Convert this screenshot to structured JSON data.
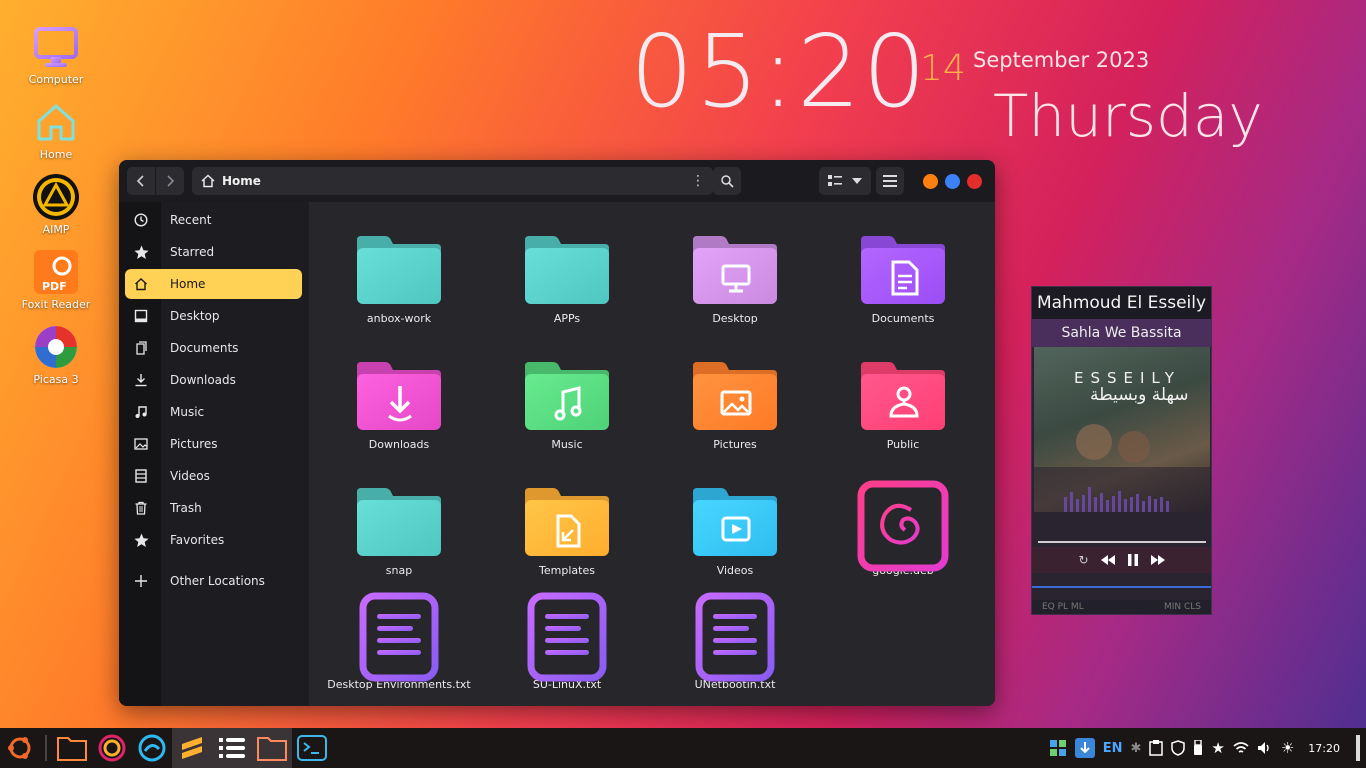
{
  "desktop": {
    "icons": [
      {
        "label": "Computer",
        "icon": "computer-icon"
      },
      {
        "label": "Home",
        "icon": "home-folder-icon"
      },
      {
        "label": "AIMP",
        "icon": "aimp-icon"
      },
      {
        "label": "Foxit Reader",
        "icon": "foxit-reader-icon",
        "badge": "PDF"
      },
      {
        "label": "Picasa 3",
        "icon": "picasa-icon"
      }
    ]
  },
  "clock": {
    "time": "05:20",
    "day": "14",
    "month_year": "September 2023",
    "weekday": "Thursday"
  },
  "file_manager": {
    "location": "Home",
    "sidebar": [
      {
        "label": "Recent",
        "icon": "clock-icon"
      },
      {
        "label": "Starred",
        "icon": "star-icon"
      },
      {
        "label": "Home",
        "icon": "home-icon",
        "active": true
      },
      {
        "label": "Desktop",
        "icon": "desktop-icon"
      },
      {
        "label": "Documents",
        "icon": "documents-icon"
      },
      {
        "label": "Downloads",
        "icon": "download-icon"
      },
      {
        "label": "Music",
        "icon": "music-icon"
      },
      {
        "label": "Pictures",
        "icon": "pictures-icon"
      },
      {
        "label": "Videos",
        "icon": "film-icon"
      },
      {
        "label": "Trash",
        "icon": "trash-icon"
      },
      {
        "label": "Favorites",
        "icon": "star-icon"
      },
      {
        "label": "Other Locations",
        "icon": "plus-icon"
      }
    ],
    "files": [
      {
        "name": "anbox-work",
        "type": "folder",
        "color": "#4fc7c0"
      },
      {
        "name": "APPs",
        "type": "folder",
        "color": "#4fc7c0"
      },
      {
        "name": "Desktop",
        "type": "folder",
        "color": "#c98ae0",
        "emblem": "monitor"
      },
      {
        "name": "Documents",
        "type": "folder",
        "color": "#9b4df5",
        "emblem": "document"
      },
      {
        "name": "Downloads",
        "type": "folder",
        "color": "#e548c7",
        "emblem": "download"
      },
      {
        "name": "Music",
        "type": "folder",
        "color": "#4fd277",
        "emblem": "music"
      },
      {
        "name": "Pictures",
        "type": "folder",
        "color": "#ff7a26",
        "emblem": "picture"
      },
      {
        "name": "Public",
        "type": "folder",
        "color": "#ff3f74",
        "emblem": "person"
      },
      {
        "name": "snap",
        "type": "folder",
        "color": "#4fc7c0"
      },
      {
        "name": "Templates",
        "type": "folder",
        "color": "#ffad2e",
        "emblem": "template"
      },
      {
        "name": "Videos",
        "type": "folder",
        "color": "#2fbdf0",
        "emblem": "video"
      },
      {
        "name": "google.deb",
        "type": "deb"
      },
      {
        "name": "Desktop Environments.txt",
        "type": "text"
      },
      {
        "name": "SU-LinuX.txt",
        "type": "text"
      },
      {
        "name": "UNetbootin.txt",
        "type": "text"
      }
    ],
    "window_controls": {
      "minimize_color": "#ff7f11",
      "maximize_color": "#3b82f6",
      "close_color": "#e42d2d"
    }
  },
  "player": {
    "artist": "Mahmoud El Esseily",
    "song": "Sahla We Bassita",
    "cover_title": "ESSEILY",
    "cover_subtitle": "سهلة وبسيطة",
    "bottom_left": "EQ PL ML",
    "bottom_right": "MIN CLS"
  },
  "taskbar": {
    "apps": [
      "ubuntu-icon",
      "files-icon",
      "firefox-icon",
      "edge-icon",
      "sublime-icon",
      "tasks-icon",
      "folder-icon",
      "terminal-icon"
    ],
    "tray": {
      "language": "EN",
      "time": "17:20"
    }
  }
}
